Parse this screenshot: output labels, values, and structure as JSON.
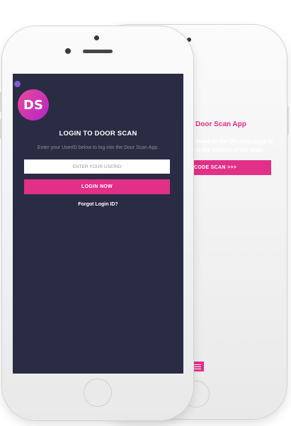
{
  "login_screen": {
    "logo_text": "DS",
    "title": "LOGIN TO DOOR SCAN",
    "subtitle": "Enter your UserID below to log into the Door Scan App.",
    "userid_placeholder": "ENTER YOUR USERID",
    "login_button": "LOGIN NOW",
    "forgot_link": "Forgot Login ID?"
  },
  "scan_screen": {
    "app_title": "Door Scan App",
    "instruction_line1": "move to the QR scan page or",
    "instruction_line2": "at the bottom of the page.",
    "scan_button": "CODE SCAN >>>"
  },
  "colors": {
    "accent": "#e22f87",
    "screen_bg": "#2a2c43",
    "phone_body": "#f3f3f3"
  },
  "icons": {
    "menu": "hamburger-icon",
    "camera": "front-camera-icon"
  }
}
